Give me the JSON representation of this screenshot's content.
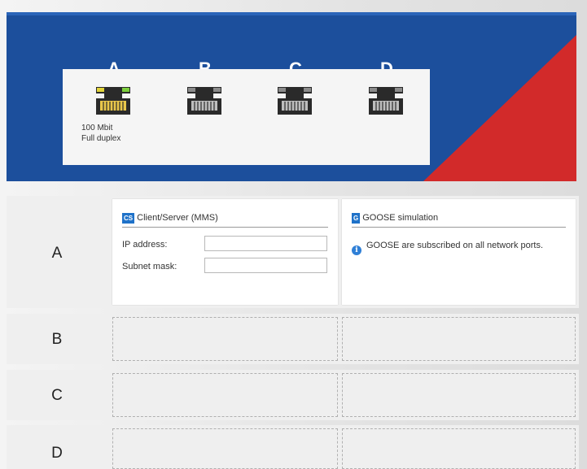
{
  "header": {
    "ports": [
      {
        "label": "A",
        "active": true
      },
      {
        "label": "B",
        "active": false
      },
      {
        "label": "C",
        "active": false
      },
      {
        "label": "D",
        "active": false
      }
    ],
    "port_a_status_line1": "100 Mbit",
    "port_a_status_line2": "Full duplex",
    "colors": {
      "blue": "#1c4f9c",
      "red": "#d22a2a"
    }
  },
  "rows": [
    {
      "letter": "A"
    },
    {
      "letter": "B"
    },
    {
      "letter": "C"
    },
    {
      "letter": "D"
    }
  ],
  "client_server": {
    "badge": "CS",
    "title": "Client/Server (MMS)",
    "ip_label": "IP address:",
    "ip_value": "",
    "subnet_label": "Subnet mask:",
    "subnet_value": ""
  },
  "goose": {
    "badge": "G",
    "title": "GOOSE simulation",
    "info_icon": "info-icon",
    "info_text": "GOOSE are subscribed on all network ports."
  }
}
